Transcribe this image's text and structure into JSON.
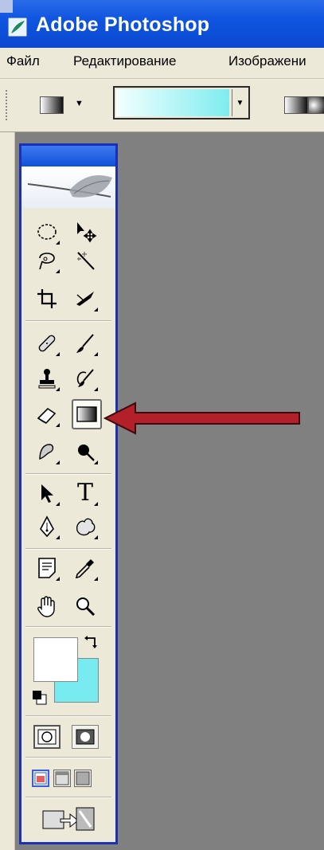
{
  "window": {
    "title": "Adobe Photoshop",
    "icon": "photoshop-feather-icon"
  },
  "menubar": {
    "items": [
      "Файл",
      "Редактирование",
      "Изображени"
    ]
  },
  "options_bar": {
    "tool_options": "gradient",
    "gradient_preset": "white-to-black",
    "gradient_picker": {
      "from": "#f4ffff",
      "to": "#7fecef"
    },
    "gradient_types": [
      "linear-gradient-icon",
      "radial-gradient-icon"
    ]
  },
  "toolbox": {
    "tools": [
      {
        "name": "elliptical-marquee-tool"
      },
      {
        "name": "move-tool"
      },
      {
        "name": "lasso-tool"
      },
      {
        "name": "magic-wand-tool"
      },
      {
        "name": "crop-tool"
      },
      {
        "name": "slice-tool"
      },
      {
        "name": "healing-brush-tool"
      },
      {
        "name": "brush-tool"
      },
      {
        "name": "clone-stamp-tool"
      },
      {
        "name": "history-brush-tool"
      },
      {
        "name": "eraser-tool"
      },
      {
        "name": "gradient-tool",
        "selected": true
      },
      {
        "name": "blur-tool"
      },
      {
        "name": "burn-tool"
      },
      {
        "name": "path-selection-tool"
      },
      {
        "name": "type-tool",
        "glyph": "T"
      },
      {
        "name": "pen-tool"
      },
      {
        "name": "custom-shape-tool"
      },
      {
        "name": "notes-tool"
      },
      {
        "name": "eyedropper-tool"
      },
      {
        "name": "hand-tool"
      },
      {
        "name": "zoom-tool"
      }
    ],
    "foreground_color": "#ffffff",
    "background_color": "#77ebef"
  },
  "annotation": {
    "arrow_color": "#b3202a",
    "points_to": "gradient-tool"
  },
  "colors": {
    "titlebar": "#0f55e0",
    "toolbox_border": "#1a30b8",
    "workspace": "#808080"
  }
}
